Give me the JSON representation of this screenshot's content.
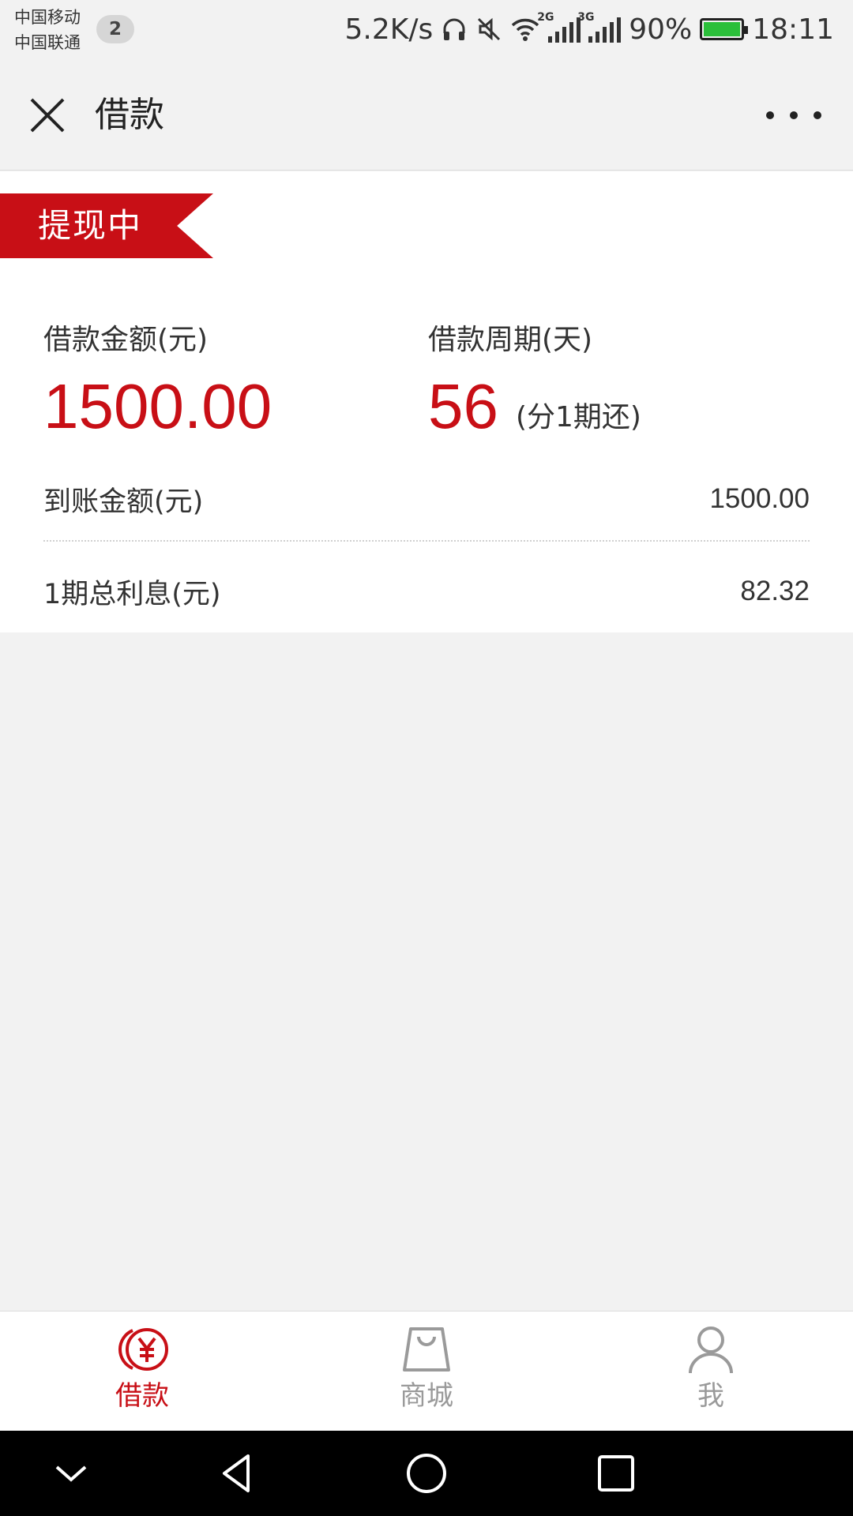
{
  "status_bar": {
    "carrier_1": "中国移动",
    "carrier_2": "中国联通",
    "sim_badge": "2",
    "net_speed": "5.2K/s",
    "signal_1_tag": "2G",
    "signal_2_tag": "3G",
    "battery": "90%",
    "time": "18:11"
  },
  "header": {
    "title": "借款",
    "close_icon": "close-icon",
    "more_icon": "more-dots-icon"
  },
  "loan": {
    "status_ribbon": "提现中",
    "amount_label": "借款金额(元)",
    "amount_value": "1500.00",
    "period_label": "借款周期(天)",
    "period_value": "56",
    "period_note": "(分1期还)",
    "received_label": "到账金额(元)",
    "received_value": "1500.00",
    "interest_label": "1期总利息(元)",
    "interest_value": "82.32"
  },
  "tabs": [
    {
      "label": "借款",
      "icon": "yuan-coin-icon",
      "active": true
    },
    {
      "label": "商城",
      "icon": "shopping-bag-icon",
      "active": false
    },
    {
      "label": "我",
      "icon": "user-icon",
      "active": false
    }
  ],
  "colors": {
    "accent": "#c80f16",
    "background": "#f2f2f2",
    "inactive_tab": "#9a9a9a"
  }
}
